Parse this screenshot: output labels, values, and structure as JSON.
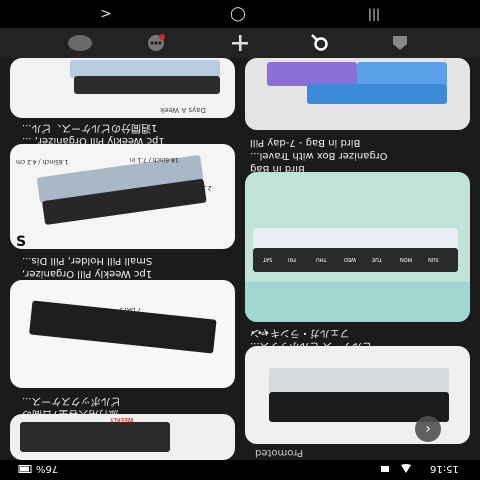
{
  "nav": {
    "back": ">",
    "home": "◯",
    "recents": "|||"
  },
  "tabs": [
    "home",
    "chat",
    "create",
    "search",
    "profile"
  ],
  "left_column": [
    {
      "caption_line1": "1pc Weekly Pill Organizer, ...",
      "caption_line2": "1週間分のピルケース、ピル...",
      "tag": "Days A Week"
    },
    {
      "caption_line1": "1pc Weekly Pill Organizer,",
      "caption_line2": "Small Pill Holder, Pill Dis...",
      "tag": "S",
      "dims1": "1.65inch / 4.2 cm",
      "dims2": "18.6inch / 7.1 in",
      "dims3": "2.250 inch"
    },
    {
      "caption_line1": "旅行用大容量7日間の",
      "caption_line2": "ピルボックスケース...",
      "tag": "7 DAYS"
    },
    {
      "caption_line1": "",
      "caption_line2": "",
      "tag": "WEEKLY"
    }
  ],
  "right_column": [
    {
      "caption_line1": "Bird in Bag - 7-day Pill",
      "caption_line2": "Organizer Box with Travel...",
      "caption_line3": "Bird in Bag"
    },
    {
      "caption_line1": "フェルガ・ランキャン",
      "caption_line2": "ピルケース ピルボックス...",
      "day_labels": [
        "SUN",
        "MON",
        "TUE",
        "WED",
        "THU",
        "FRI",
        "SAT"
      ]
    },
    {
      "caption_line1": "Promoted",
      "caption_line2": ""
    }
  ],
  "more": "•••",
  "status": {
    "time": "15:16",
    "battery": "76%"
  }
}
